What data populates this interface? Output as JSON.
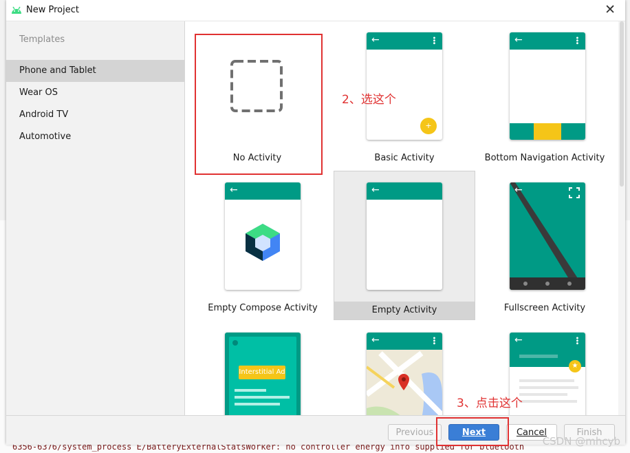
{
  "window": {
    "title": "New Project",
    "close_symbol": "✕"
  },
  "sidebar": {
    "heading": "Templates",
    "items": [
      {
        "label": "Phone and Tablet",
        "selected": true
      },
      {
        "label": "Wear OS",
        "selected": false
      },
      {
        "label": "Android TV",
        "selected": false
      },
      {
        "label": "Automotive",
        "selected": false
      }
    ]
  },
  "templates": [
    {
      "label": "No Activity",
      "icon": "dashed-square-icon",
      "highlighted": true
    },
    {
      "label": "Basic Activity",
      "icon": "phone-preview-fab"
    },
    {
      "label": "Bottom Navigation Activity",
      "icon": "phone-preview-bottom-nav"
    },
    {
      "label": "Empty Compose Activity",
      "icon": "compose-logo-icon"
    },
    {
      "label": "Empty Activity",
      "icon": "phone-preview-empty",
      "hovered": true
    },
    {
      "label": "Fullscreen Activity",
      "icon": "phone-preview-fullscreen"
    },
    {
      "label": "",
      "icon": "phone-preview-interstitial",
      "badge": "Interstitial Ad"
    },
    {
      "label": "",
      "icon": "phone-preview-map"
    },
    {
      "label": "",
      "icon": "phone-preview-scrolling"
    }
  ],
  "annotations": {
    "step2": "2、选这个",
    "step3": "3、点击这个"
  },
  "footer": {
    "previous": "Previous",
    "next": "Next",
    "cancel": "Cancel",
    "finish": "Finish"
  },
  "background_log": "6356-6376/system_process E/BatteryExternalStatsWorker: no controller energy info supplied for bluetooth",
  "watermark": "CSDN @mhcyb",
  "colors": {
    "accent": "#009a85",
    "primary_button": "#3a7ed6",
    "annotation": "#e03131",
    "fab": "#f5c518"
  }
}
